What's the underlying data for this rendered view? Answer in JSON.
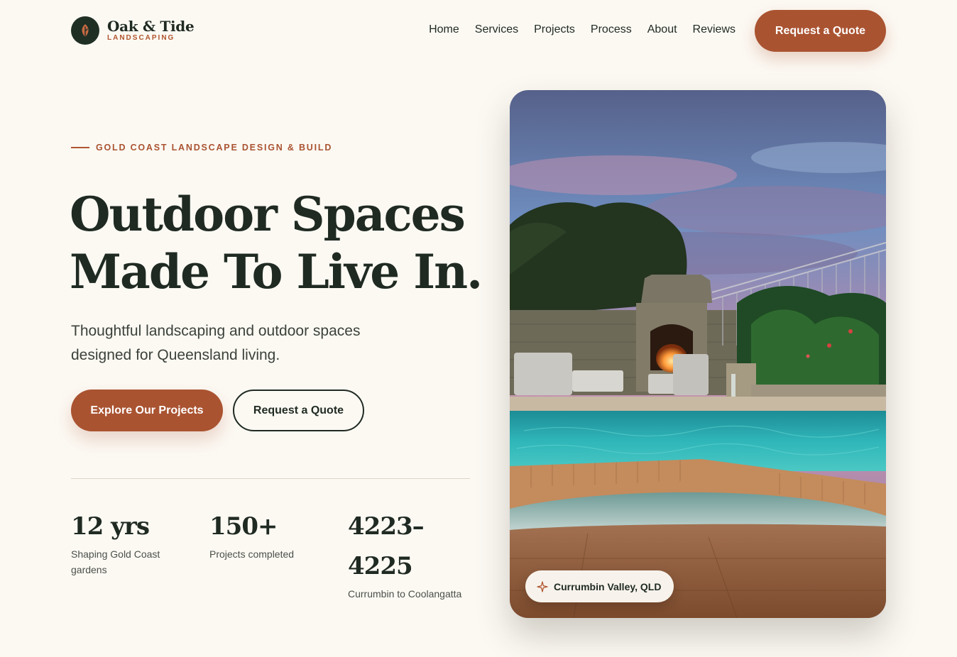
{
  "brand": {
    "name": "Oak & Tide",
    "tagline": "LANDSCAPING",
    "logo_icon": "leaf-icon"
  },
  "nav": {
    "items": [
      "Home",
      "Services",
      "Projects",
      "Process",
      "About",
      "Reviews"
    ],
    "cta_label": "Request a Quote"
  },
  "hero": {
    "eyebrow": "GOLD COAST LANDSCAPE DESIGN & BUILD",
    "headline_line1": "Outdoor Spaces",
    "headline_line2": "Made To Live In.",
    "subheading": "Thoughtful landscaping and outdoor spaces designed for Queensland living.",
    "primary_button": "Explore Our Projects",
    "secondary_button": "Request a Quote",
    "image_location": "Currumbin Valley, QLD",
    "location_icon": "sparkle-icon"
  },
  "stats": [
    {
      "value": "12 yrs",
      "label": "Shaping Gold Coast gardens"
    },
    {
      "value": "150+",
      "label": "Projects completed"
    },
    {
      "value": "4223–4225",
      "label": "Currumbin to Coolangatta"
    }
  ],
  "colors": {
    "background": "#fcf9f3",
    "accent": "#aa5331",
    "ink": "#1f2a22"
  }
}
